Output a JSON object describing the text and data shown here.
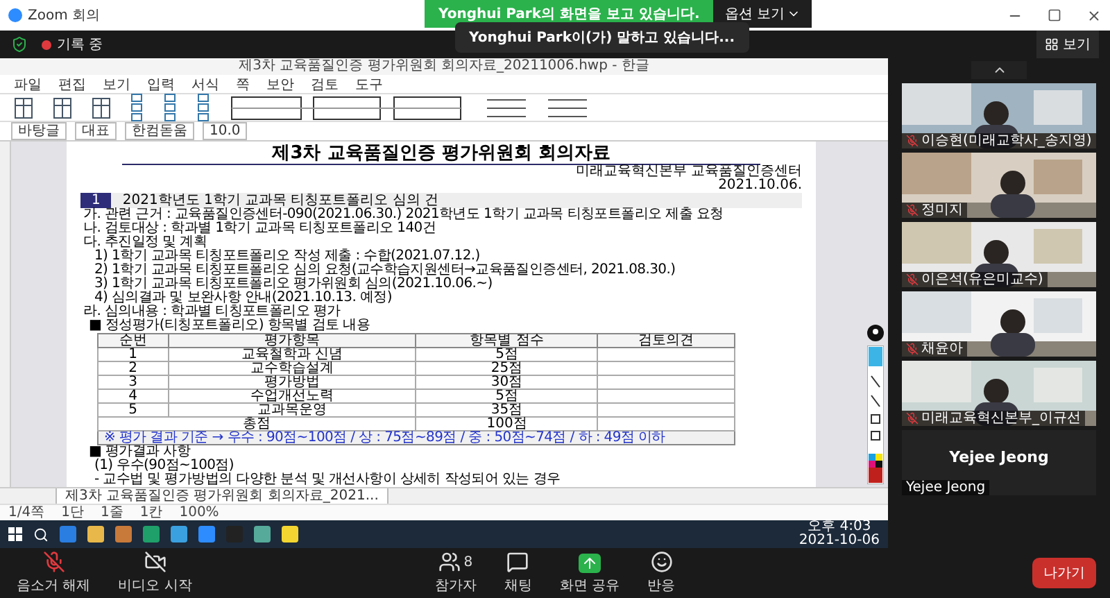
{
  "zoom_window": {
    "title": "Zoom 회의"
  },
  "share_banner": {
    "text": "Yonghui Park의 화면을 보고 있습니다.",
    "options_button": "옵션 보기"
  },
  "meeting_header": {
    "recording": "기록 중",
    "speaker_toast": "Yonghui Park이(가) 말하고 있습니다...",
    "view_button": "보기"
  },
  "shared_screen": {
    "window_title": "제3차 교육품질인증 평가위원회 회의자료_20211006.hwp - 한글",
    "menu": [
      "파일",
      "편집",
      "보기",
      "입력",
      "서식",
      "쪽",
      "보안",
      "검토",
      "도구"
    ],
    "toolbar_fields": [
      "바탕글",
      "대표",
      "한컴돋움",
      "10.0"
    ],
    "document": {
      "blocks": [
        {
          "kind": "title",
          "text": "제3차 교육품질인증 평가위원회 회의자료"
        },
        {
          "kind": "right",
          "text": "미래교육혁신본부 교육품질인증센터"
        },
        {
          "kind": "right",
          "text": "2021.10.06."
        },
        {
          "kind": "section",
          "number": "1",
          "text": "2021학년도 1학기 교과목 티칭포트폴리오 심의 건"
        },
        {
          "kind": "line",
          "text": "가. 관련 근거 : 교육품질인증센터-090(2021.06.30.) 2021학년도 1학기 교과목 티칭포트폴리오 제출 요청"
        },
        {
          "kind": "line",
          "text": "나. 검토대상 : 학과별 1학기 교과목 티칭포트폴리오 140건"
        },
        {
          "kind": "line",
          "text": "다. 추진일정 및 계획"
        },
        {
          "kind": "indent",
          "text": "1) 1학기 교과목 티칭포트폴리오 작성 제출 : 수합(2021.07.12.)"
        },
        {
          "kind": "indent",
          "text": "2) 1학기 교과목 티칭포트폴리오 심의 요청(교수학습지원센터→교육품질인증센터, 2021.08.30.)"
        },
        {
          "kind": "indent",
          "text": "3) 1학기 교과목 티칭포트폴리오 평가위원회 심의(2021.10.06.~)"
        },
        {
          "kind": "indent",
          "text": "4) 심의결과 및 보완사항 안내(2021.10.13. 예정)"
        },
        {
          "kind": "line",
          "text": "라. 심의내용 : 학과별 티칭포트폴리오 평가"
        },
        {
          "kind": "bullet",
          "text": "■ 정성평가(티칭포트폴리오) 항목별 검토 내용"
        },
        {
          "kind": "table",
          "columns": [
            "순번",
            "평가항목",
            "항목별 점수",
            "검토의견"
          ],
          "rows": [
            [
              "1",
              "교육철학과 신념",
              "5점"
            ],
            [
              "2",
              "교수학습설계",
              "25점"
            ],
            [
              "3",
              "평가방법",
              "30점"
            ],
            [
              "4",
              "수업개선노력",
              "5점"
            ],
            [
              "5",
              "교과목운영",
              "35점"
            ]
          ],
          "total": {
            "label": "총점",
            "score": "100점"
          },
          "legend": "※ 평가 결과 기준 → 우수 : 90점~100점 / 상 : 75점~89점 / 중 : 50점~74점 / 하 : 49점 이하"
        },
        {
          "kind": "bullet",
          "text": "■ 평가결과 사항"
        },
        {
          "kind": "indent",
          "text": "(1) 우수(90점~100점)"
        },
        {
          "kind": "indent",
          "text": "- 교수법 및 평가방법의 다양한 분석 및 개선사항이 상세히 작성되어 있는 경우"
        }
      ]
    },
    "sheet_tab": "제3차 교육품질인증 평가위원회 회의자료_2021...",
    "status_bar": [
      "1/4쪽",
      "1단",
      "1줄",
      "1칸",
      "100%"
    ],
    "taskbar": {
      "time": "오후 4:03",
      "date": "2021-10-06"
    }
  },
  "participants": [
    {
      "kind": "video",
      "name": "이승현(미래교학사_송지영)",
      "muted": true
    },
    {
      "kind": "video",
      "name": "정미지",
      "muted": true
    },
    {
      "kind": "video",
      "name": "이은석(유은미교수)",
      "muted": true
    },
    {
      "kind": "video",
      "name": "채윤아",
      "muted": true
    },
    {
      "kind": "video",
      "name": "미래교육혁신본부_이규선",
      "muted": true
    },
    {
      "kind": "name_only",
      "display": "Yejee Jeong",
      "name": "Yejee Jeong",
      "muted": false
    }
  ],
  "toolbar": [
    {
      "kind": "mic",
      "label": "음소거 해제"
    },
    {
      "kind": "video",
      "label": "비디오 시작"
    },
    {
      "kind": "participants",
      "label": "참가자",
      "count": "8"
    },
    {
      "kind": "chat",
      "label": "채팅"
    },
    {
      "kind": "share",
      "label": "화면 공유"
    },
    {
      "kind": "reactions",
      "label": "반응"
    }
  ],
  "leave_button": "나가기"
}
